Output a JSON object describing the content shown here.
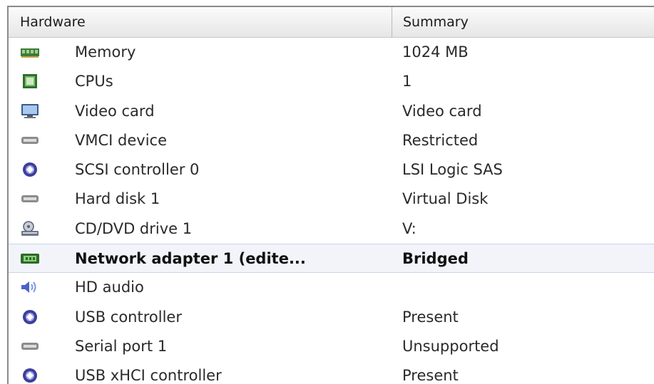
{
  "columns": {
    "hardware": "Hardware",
    "summary": "Summary"
  },
  "devices": [
    {
      "icon": "memory-icon",
      "name": "Memory",
      "summary": "1024 MB"
    },
    {
      "icon": "cpu-icon",
      "name": "CPUs",
      "summary": "1"
    },
    {
      "icon": "monitor-icon",
      "name": "Video card",
      "summary": "Video card"
    },
    {
      "icon": "device-icon",
      "name": "VMCI device",
      "summary": "Restricted"
    },
    {
      "icon": "controller-icon",
      "name": "SCSI controller 0",
      "summary": "LSI Logic SAS"
    },
    {
      "icon": "disk-icon",
      "name": "Hard disk 1",
      "summary": "Virtual Disk"
    },
    {
      "icon": "cd-drive-icon",
      "name": "CD/DVD drive 1",
      "summary": "V:"
    },
    {
      "icon": "network-adapter-icon",
      "name": "Network adapter 1 (edite...",
      "summary": "Bridged"
    },
    {
      "icon": "speaker-icon",
      "name": "HD audio",
      "summary": ""
    },
    {
      "icon": "usb-controller-icon",
      "name": "USB controller",
      "summary": "Present"
    },
    {
      "icon": "serial-port-icon",
      "name": "Serial port 1",
      "summary": "Unsupported"
    },
    {
      "icon": "usb-xhci-controller-icon",
      "name": "USB xHCI controller",
      "summary": "Present"
    }
  ],
  "selected_device": "Network adapter 1 (edite..."
}
